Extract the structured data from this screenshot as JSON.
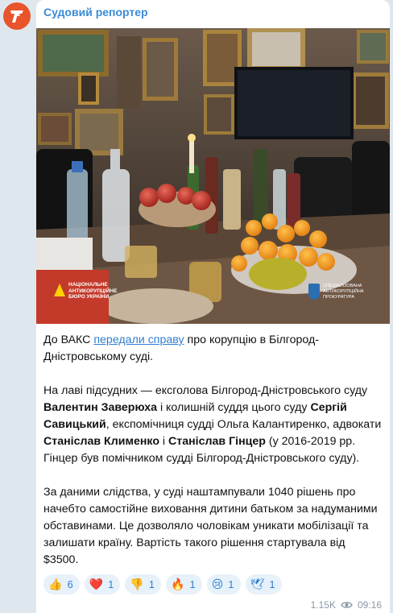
{
  "channel": {
    "name": "Судовий репортер"
  },
  "photo": {
    "watermark_left": [
      "НАЦІОНАЛЬНЕ",
      "АНТИКОРУПЦІЙНЕ",
      "БЮРО УКРАЇНИ"
    ],
    "watermark_right": [
      "СПЕЦІАЛІЗОВАНА",
      "АНТИКОРУПЦІЙНА",
      "ПРОКУРАТУРА"
    ]
  },
  "post": {
    "p1_before": "До ВАКС ",
    "p1_link": "передали справу",
    "p1_after": " про корупцію в  Білгород-Дністровському суді.",
    "p2_a": "На лаві підсудних — ексголова Білгород-Дністровського суду ",
    "p2_b": "Валентин Заверюха",
    "p2_c": " і колишній суддя цього суду ",
    "p2_d": "Сергій Савицький",
    "p2_e": ", експомічниця судді Ольга Калантиренко, адвокати ",
    "p2_f": "Станіслав Клименко",
    "p2_g": " і ",
    "p2_h": "Станіслав Гінцер",
    "p2_i": " (у 2016-2019 рр. Гінцер був помічником судді Білгород-Дністровського суду).",
    "p3": "За даними слідства, у суді наштампували 1040 рішень про начебто самостійне виховання дитини батьком за надуманими обставинами. Це дозволяло чоловікам уникати мобілізації та залишати країну. Вартість такого рішення стартувала від $3500."
  },
  "reactions": [
    {
      "emoji": "👍",
      "count": "6"
    },
    {
      "emoji": "❤️",
      "count": "1"
    },
    {
      "emoji": "👎",
      "count": "1"
    },
    {
      "emoji": "🔥",
      "count": "1"
    },
    {
      "emoji": "😢",
      "count": "1"
    },
    {
      "emoji": "🕊",
      "count": "1"
    }
  ],
  "meta": {
    "views": "1.15K",
    "time": "09:16"
  },
  "colors": {
    "accent": "#3a8cd6",
    "avatar": "#e8542b",
    "reaction_bg": "#e7f1fa"
  }
}
